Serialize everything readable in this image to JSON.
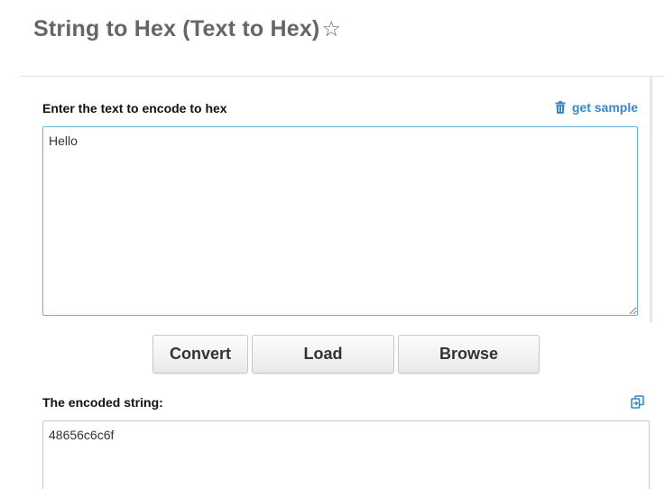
{
  "header": {
    "title": "String to Hex (Text to Hex)",
    "favorite_icon": "star-outline-icon"
  },
  "input_section": {
    "label": "Enter the text to encode to hex",
    "get_sample_label": "get sample",
    "get_sample_icon": "trash-icon",
    "value": "Hello"
  },
  "actions": {
    "convert_label": "Convert",
    "load_label": "Load",
    "browse_label": "Browse"
  },
  "output_section": {
    "label": "The encoded string:",
    "copy_icon": "copy-icon",
    "value": "48656c6c6f"
  },
  "colors": {
    "title": "#666666",
    "link": "#3a87c8",
    "input_border": "#69b1d6"
  }
}
